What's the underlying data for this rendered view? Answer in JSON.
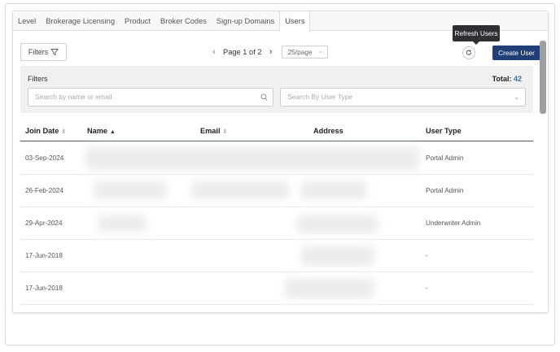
{
  "tabs": [
    {
      "label": "Level",
      "active": false
    },
    {
      "label": "Brokerage Licensing",
      "active": false
    },
    {
      "label": "Product",
      "active": false
    },
    {
      "label": "Broker Codes",
      "active": false
    },
    {
      "label": "Sign-up Domains",
      "active": false
    },
    {
      "label": "Users",
      "active": true
    }
  ],
  "toolbar": {
    "filters_label": "Filters",
    "page_label": "Page 1 of 2",
    "per_page": "25/page",
    "refresh_tooltip": "Refresh Users",
    "create_label": "Create User"
  },
  "filter_panel": {
    "title": "Filters",
    "total_label": "Total:",
    "total_value": "42",
    "search_placeholder": "Search by name or email",
    "type_placeholder": "Search By User Type"
  },
  "table": {
    "headers": {
      "join_date": "Join Date",
      "name": "Name",
      "email": "Email",
      "address": "Address",
      "user_type": "User Type"
    },
    "rows": [
      {
        "join_date": "03-Sep-2024",
        "user_type": "Portal Admin"
      },
      {
        "join_date": "26-Feb-2024",
        "user_type": "Portal Admin"
      },
      {
        "join_date": "29-Apr-2024",
        "user_type": "Underwriter Admin"
      },
      {
        "join_date": "17-Jun-2018",
        "user_type": "-"
      },
      {
        "join_date": "17-Jun-2018",
        "user_type": "-"
      }
    ]
  },
  "colors": {
    "primary_button": "#1f3f76",
    "total_value": "#3a6fa8",
    "tooltip_bg": "#2f3033"
  }
}
